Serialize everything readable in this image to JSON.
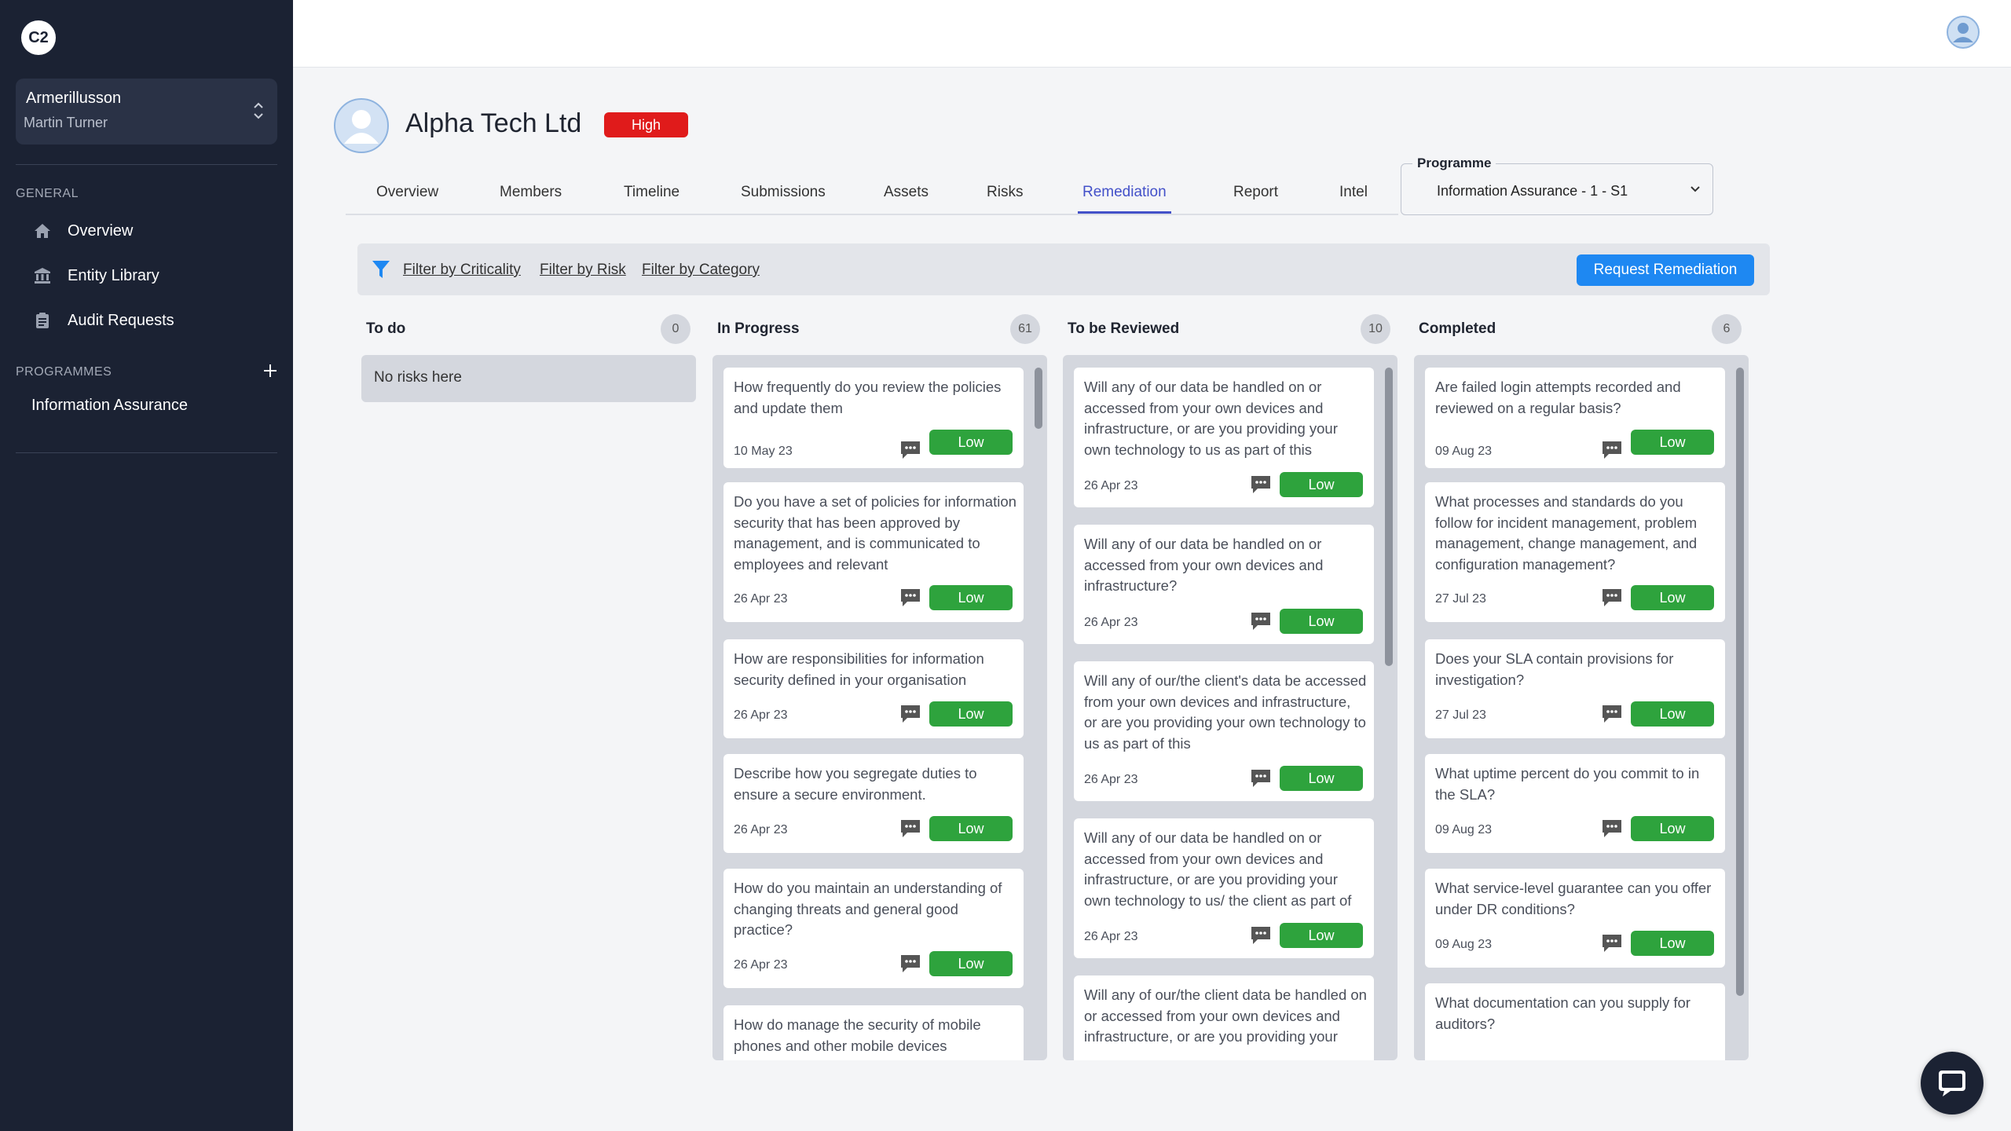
{
  "app": {
    "logo_text": "C2"
  },
  "sidebar": {
    "org_name": "Armerillusson",
    "user_name": "Martin Turner",
    "general_heading": "GENERAL",
    "items": [
      {
        "label": "Overview",
        "icon": "home-icon"
      },
      {
        "label": "Entity Library",
        "icon": "bank-icon"
      },
      {
        "label": "Audit Requests",
        "icon": "clipboard-icon"
      }
    ],
    "programmes_heading": "PROGRAMMES",
    "programmes": [
      {
        "label": "Information Assurance"
      }
    ]
  },
  "entity": {
    "name": "Alpha Tech Ltd",
    "risk_level": "High",
    "risk_color": "#e01b1b"
  },
  "tabs": [
    {
      "label": "Overview"
    },
    {
      "label": "Members"
    },
    {
      "label": "Timeline"
    },
    {
      "label": "Submissions"
    },
    {
      "label": "Assets"
    },
    {
      "label": "Risks"
    },
    {
      "label": "Remediation",
      "active": true
    },
    {
      "label": "Report"
    },
    {
      "label": "Intel"
    }
  ],
  "programme_select": {
    "label": "Programme",
    "value": "Information Assurance - 1 - S1"
  },
  "filters": {
    "criticality": "Filter by Criticality",
    "risk": "Filter by Risk",
    "category": "Filter by Category",
    "request_button": "Request Remediation"
  },
  "columns": [
    {
      "title": "To do",
      "count": "0",
      "empty_text": "No risks here",
      "cards": []
    },
    {
      "title": "In Progress",
      "count": "61",
      "cards": [
        {
          "question": "How frequently do you review the policies and update them",
          "date": "10 May 23",
          "level": "Low"
        },
        {
          "question": "Do you have a set of policies for information security that has been approved by management, and is communicated to employees and relevant",
          "date": "26 Apr 23",
          "level": "Low"
        },
        {
          "question": "How are responsibilities for information security defined in your organisation",
          "date": "26 Apr 23",
          "level": "Low"
        },
        {
          "question": "Describe how you segregate duties to ensure a secure environment.",
          "date": "26 Apr 23",
          "level": "Low"
        },
        {
          "question": "How do you maintain an understanding of changing threats and general good practice?",
          "date": "26 Apr 23",
          "level": "Low"
        },
        {
          "question": "How do manage the security of mobile phones and other mobile devices",
          "date": "",
          "level": ""
        }
      ]
    },
    {
      "title": "To be Reviewed",
      "count": "10",
      "cards": [
        {
          "question": "Will any of our data be handled on or accessed from your own devices and infrastructure, or are you providing your own technology to us as part of this",
          "date": "26 Apr 23",
          "level": "Low"
        },
        {
          "question": "Will any of our data be handled on or accessed from your own devices and infrastructure?",
          "date": "26 Apr 23",
          "level": "Low"
        },
        {
          "question": "Will any of our/the client's data be accessed from your own devices and infrastructure, or are you providing your own technology to us as part of this",
          "date": "26 Apr 23",
          "level": "Low"
        },
        {
          "question": "Will any of our data be handled on or accessed from your own devices and infrastructure, or are you providing your own technology to us/ the client as part of",
          "date": "26 Apr 23",
          "level": "Low"
        },
        {
          "question": "Will any of our/the client data be handled on or accessed from your own devices and infrastructure, or are you providing your",
          "date": "",
          "level": ""
        }
      ]
    },
    {
      "title": "Completed",
      "count": "6",
      "cards": [
        {
          "question": "Are failed login attempts recorded and reviewed on a regular basis?",
          "date": "09 Aug 23",
          "level": "Low"
        },
        {
          "question": "What processes and standards do you follow for incident management, problem management, change management, and configuration management?",
          "date": "27 Jul 23",
          "level": "Low"
        },
        {
          "question": "Does your SLA contain provisions for investigation?",
          "date": "27 Jul 23",
          "level": "Low"
        },
        {
          "question": "What uptime percent do you commit to in the SLA?",
          "date": "09 Aug 23",
          "level": "Low"
        },
        {
          "question": "What service-level guarantee can you offer under DR conditions?",
          "date": "09 Aug 23",
          "level": "Low"
        },
        {
          "question": "What documentation can you supply for auditors?",
          "date": "",
          "level": ""
        }
      ]
    }
  ]
}
